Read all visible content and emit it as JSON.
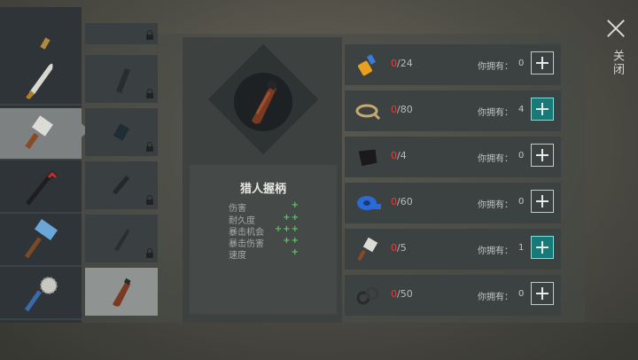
{
  "weapons": [
    {
      "name": "pipe-top-icon"
    },
    {
      "name": "machete-icon"
    },
    {
      "name": "cleaver-icon"
    },
    {
      "name": "crowbar-icon"
    },
    {
      "name": "hammer-icon"
    },
    {
      "name": "saw-mace-icon"
    }
  ],
  "variants": [
    {
      "name": "blade-dark-icon",
      "locked": true
    },
    {
      "name": "blade-part-icon",
      "locked": true
    },
    {
      "name": "blade-blue-icon",
      "locked": true
    },
    {
      "name": "handle-dark-icon",
      "locked": true
    },
    {
      "name": "handle-grey-icon",
      "locked": true
    },
    {
      "name": "hunter-handle-icon",
      "locked": false
    }
  ],
  "item": {
    "name": "猎人握柄",
    "icon": "hunter-handle-icon"
  },
  "stats": [
    {
      "label": "伤害",
      "value": "+"
    },
    {
      "label": "耐久度",
      "value": "++"
    },
    {
      "label": "暴击机会",
      "value": "+++"
    },
    {
      "label": "暴击伤害",
      "value": "++"
    },
    {
      "label": "速度",
      "value": "+"
    }
  ],
  "materials": [
    {
      "icon": "glue-icon",
      "current": "0",
      "required": "/24",
      "owned_label": "你拥有：",
      "owned": "0",
      "active": false
    },
    {
      "icon": "rope-icon",
      "current": "0",
      "required": "/80",
      "owned_label": "你拥有：",
      "owned": "4",
      "active": true
    },
    {
      "icon": "leather-icon",
      "current": "0",
      "required": "/4",
      "owned_label": "你拥有：",
      "owned": "0",
      "active": false
    },
    {
      "icon": "tape-icon",
      "current": "0",
      "required": "/60",
      "owned_label": "你拥有：",
      "owned": "0",
      "active": false
    },
    {
      "icon": "cleaver-icon",
      "current": "0",
      "required": "/5",
      "owned_label": "你拥有：",
      "owned": "1",
      "active": true
    },
    {
      "icon": "washers-icon",
      "current": "0",
      "required": "/50",
      "owned_label": "你拥有：",
      "owned": "0",
      "active": false
    }
  ],
  "close": {
    "label": "关闭"
  },
  "colors": {
    "required_red": "#e04040",
    "stat_green": "#58c860",
    "active_teal": "#177a78"
  }
}
